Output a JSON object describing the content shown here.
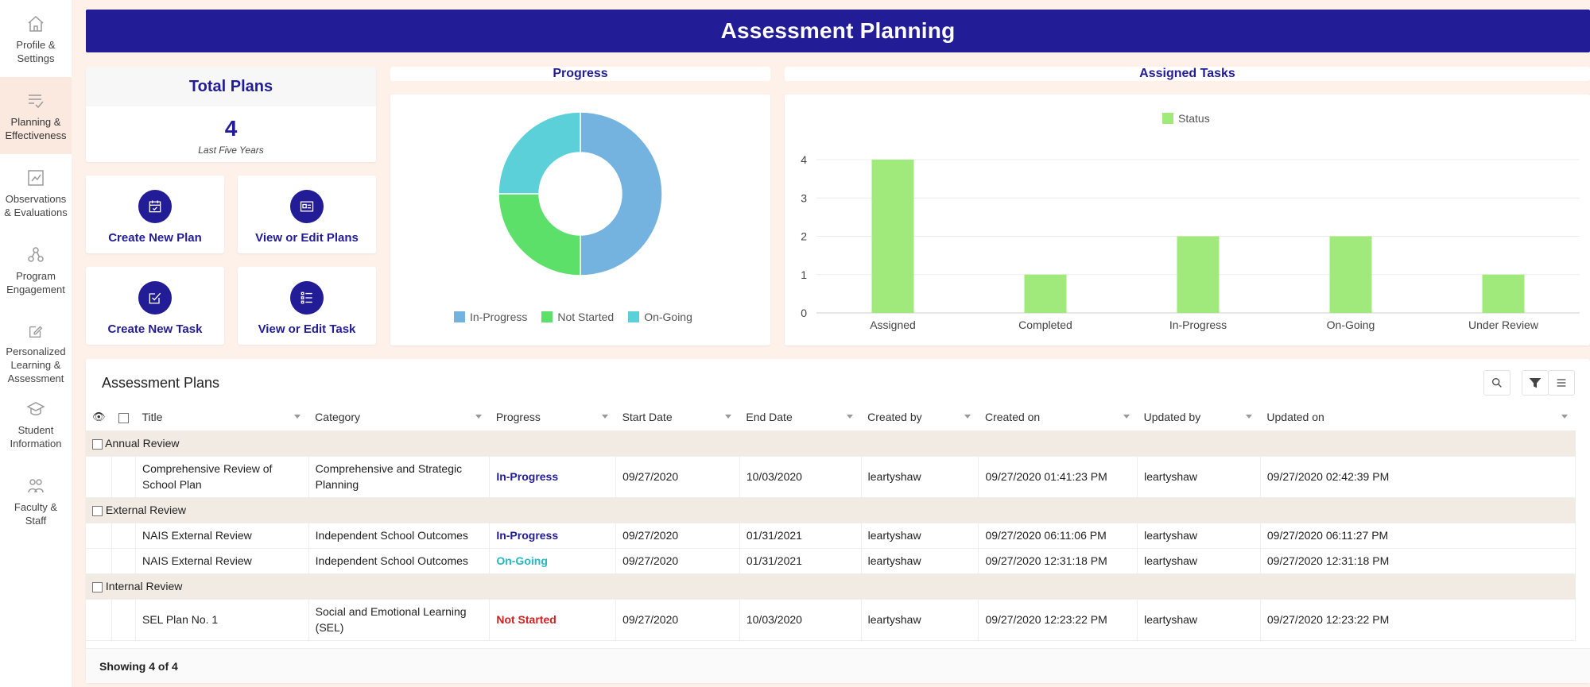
{
  "sidebar": {
    "items": [
      {
        "label": "Profile &\nSettings",
        "icon": "home-icon"
      },
      {
        "label": "Planning &\nEffectiveness",
        "icon": "checklist-icon",
        "active": true
      },
      {
        "label": "Observations\n& Evaluations",
        "icon": "chart-board-icon"
      },
      {
        "label": "Program\nEngagement",
        "icon": "network-icon"
      },
      {
        "label": "Personalized\nLearning &\nAssessment",
        "icon": "edit-icon"
      },
      {
        "label": "Student\nInformation",
        "icon": "graduation-icon"
      },
      {
        "label": "Faculty &\nStaff",
        "icon": "group-icon"
      }
    ]
  },
  "header": {
    "title": "Assessment Planning"
  },
  "total": {
    "title": "Total Plans",
    "value": "4",
    "subtitle": "Last Five Years"
  },
  "actions": {
    "create_plan": "Create New Plan",
    "view_plans": "View or Edit Plans",
    "create_task": "Create New Task",
    "view_tasks": "View or Edit Task"
  },
  "progress_panel": {
    "title": "Progress"
  },
  "tasks_panel": {
    "title": "Assigned Tasks"
  },
  "colors": {
    "primary": "#221c96",
    "in_progress": "#74b3e0",
    "not_started": "#5de06a",
    "on_going": "#5bd0d8",
    "bar": "#9fea7a",
    "status_red": "#d0201f",
    "status_teal": "#25b8c2"
  },
  "chart_data": [
    {
      "type": "pie",
      "donut": true,
      "labels": [
        "In-Progress",
        "Not Started",
        "On-Going"
      ],
      "values": [
        2,
        1,
        1
      ],
      "legend": "bottom"
    },
    {
      "type": "bar",
      "categories": [
        "Assigned",
        "Completed",
        "In-Progress",
        "On-Going",
        "Under Review"
      ],
      "series": [
        {
          "name": "Status",
          "values": [
            4,
            1,
            2,
            2,
            1
          ]
        }
      ],
      "ylim": [
        0,
        4
      ],
      "yticks": [
        "0",
        "1",
        "2",
        "3",
        "4"
      ],
      "legend": "top",
      "grid": true
    }
  ],
  "table": {
    "title": "Assessment Plans",
    "columns": [
      "Title",
      "Category",
      "Progress",
      "Start Date",
      "End Date",
      "Created by",
      "Created on",
      "Updated by",
      "Updated on"
    ],
    "groups": [
      {
        "name": "Annual Review",
        "rows": [
          [
            "Comprehensive Review of School Plan",
            "Comprehensive and Strategic Planning",
            "In-Progress",
            "09/27/2020",
            "10/03/2020",
            "leartyshaw",
            "09/27/2020 01:41:23 PM",
            "leartyshaw",
            "09/27/2020 02:42:39 PM"
          ]
        ]
      },
      {
        "name": "External Review",
        "rows": [
          [
            "NAIS External Review",
            "Independent School Outcomes",
            "In-Progress",
            "09/27/2020",
            "01/31/2021",
            "leartyshaw",
            "09/27/2020 06:11:06 PM",
            "leartyshaw",
            "09/27/2020 06:11:27 PM"
          ],
          [
            "NAIS External Review",
            "Independent School Outcomes",
            "On-Going",
            "09/27/2020",
            "01/31/2021",
            "leartyshaw",
            "09/27/2020 12:31:18 PM",
            "leartyshaw",
            "09/27/2020 12:31:18 PM"
          ]
        ]
      },
      {
        "name": "Internal Review",
        "rows": [
          [
            "SEL Plan No. 1",
            "Social and Emotional Learning (SEL)",
            "Not Started",
            "09/27/2020",
            "10/03/2020",
            "leartyshaw",
            "09/27/2020 12:23:22 PM",
            "leartyshaw",
            "09/27/2020 12:23:22 PM"
          ]
        ]
      }
    ],
    "footer": "Showing 4 of 4"
  }
}
